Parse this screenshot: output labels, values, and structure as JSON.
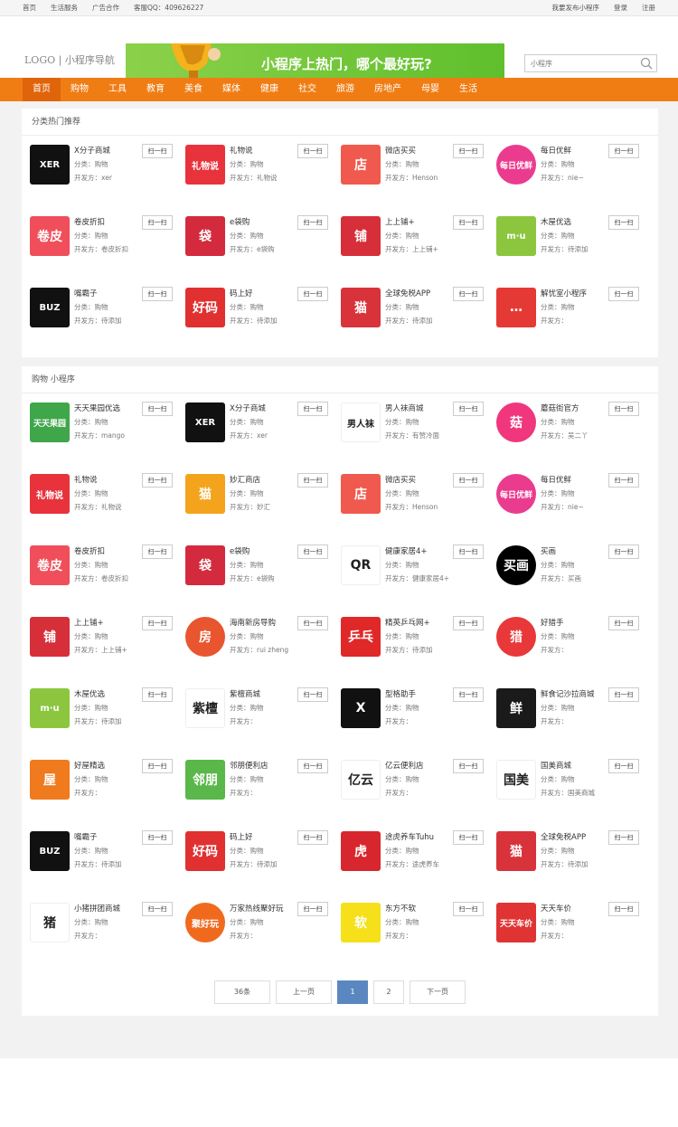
{
  "topbar": {
    "left": [
      "首页",
      "生活服务",
      "广告合作",
      "客服QQ：409626227"
    ],
    "right": [
      "我要发布小程序",
      "登录",
      "注册"
    ]
  },
  "header": {
    "logo": "LOGO | 小程序导航",
    "banner_text": "小程序上热门，哪个最好玩?",
    "search_placeholder": "小程序"
  },
  "nav": {
    "items": [
      "首页",
      "购物",
      "工具",
      "教育",
      "美食",
      "媒体",
      "健康",
      "社交",
      "旅游",
      "房地产",
      "母婴",
      "生活"
    ],
    "active": "首页"
  },
  "sections": [
    {
      "title": "分类热门推荐",
      "cards": [
        {
          "name": "X分子商城",
          "cat": "分类：购物",
          "dev": "开发方：xer",
          "icon": "XER",
          "bg": "#111111"
        },
        {
          "name": "礼物说",
          "cat": "分类：购物",
          "dev": "开发方：礼物说",
          "icon": "礼物说",
          "bg": "#e8333c"
        },
        {
          "name": "微店买买",
          "cat": "分类：购物",
          "dev": "开发方：Henson",
          "icon": "店",
          "bg": "#f05a4e"
        },
        {
          "name": "每日优鲜",
          "cat": "分类：购物",
          "dev": "开发方：nie~",
          "icon": "每日优鲜",
          "bg": "#ea3b8f"
        },
        {
          "name": "卷皮折扣",
          "cat": "分类：购物",
          "dev": "开发方：卷皮折扣",
          "icon": "卷皮",
          "bg": "#f04e5a"
        },
        {
          "name": "e袋购",
          "cat": "分类：购物",
          "dev": "开发方：e袋购",
          "icon": "袋",
          "bg": "#d42a3e"
        },
        {
          "name": "上上铺+",
          "cat": "分类：购物",
          "dev": "开发方：上上铺+",
          "icon": "铺",
          "bg": "#d72f3a"
        },
        {
          "name": "木屋优选",
          "cat": "分类：购物",
          "dev": "开发方：待添加",
          "icon": "m·u",
          "bg": "#8cc63e"
        },
        {
          "name": "嘴霸子",
          "cat": "分类：购物",
          "dev": "开发方：待添加",
          "icon": "BUZ",
          "bg": "#111111"
        },
        {
          "name": "码上好",
          "cat": "分类：购物",
          "dev": "开发方：待添加",
          "icon": "好码",
          "bg": "#e03030"
        },
        {
          "name": "全球免税APP",
          "cat": "分类：购物",
          "dev": "开发方：待添加",
          "icon": "猫",
          "bg": "#d8333a"
        },
        {
          "name": "解忧室小程序",
          "cat": "分类：购物",
          "dev": "开发方：",
          "icon": "…",
          "bg": "#e53935"
        }
      ]
    },
    {
      "title": "购物 小程序",
      "cards": [
        {
          "name": "天天果园优选",
          "cat": "分类：购物",
          "dev": "开发方：mango",
          "icon": "天天果园",
          "bg": "#3fa64a"
        },
        {
          "name": "X分子商城",
          "cat": "分类：购物",
          "dev": "开发方：xer",
          "icon": "XER",
          "bg": "#111111"
        },
        {
          "name": "男人袜商城",
          "cat": "分类：购物",
          "dev": "开发方：有赞冷面",
          "icon": "男人袜",
          "bg": "#ffffff"
        },
        {
          "name": "蘑菇街官方",
          "cat": "分类：购物",
          "dev": "开发方：吴二丫",
          "icon": "菇",
          "bg": "#f0367c"
        },
        {
          "name": "礼物说",
          "cat": "分类：购物",
          "dev": "开发方：礼物说",
          "icon": "礼物说",
          "bg": "#e8333c"
        },
        {
          "name": "妙汇商店",
          "cat": "分类：购物",
          "dev": "开发方：妙汇",
          "icon": "猫",
          "bg": "#f4a41c"
        },
        {
          "name": "微店买买",
          "cat": "分类：购物",
          "dev": "开发方：Henson",
          "icon": "店",
          "bg": "#f05a4e"
        },
        {
          "name": "每日优鲜",
          "cat": "分类：购物",
          "dev": "开发方：nie~",
          "icon": "每日优鲜",
          "bg": "#ea3b8f"
        },
        {
          "name": "卷皮折扣",
          "cat": "分类：购物",
          "dev": "开发方：卷皮折扣",
          "icon": "卷皮",
          "bg": "#f04e5a"
        },
        {
          "name": "e袋购",
          "cat": "分类：购物",
          "dev": "开发方：e袋购",
          "icon": "袋",
          "bg": "#d42a3e"
        },
        {
          "name": "健康家居4+",
          "cat": "分类：购物",
          "dev": "开发方：健康家居4+",
          "icon": "QR",
          "bg": "#ffffff"
        },
        {
          "name": "买画",
          "cat": "分类：购物",
          "dev": "开发方：买画",
          "icon": "买画",
          "bg": "#000000"
        },
        {
          "name": "上上铺+",
          "cat": "分类：购物",
          "dev": "开发方：上上铺+",
          "icon": "铺",
          "bg": "#d72f3a"
        },
        {
          "name": "海南新房导购",
          "cat": "分类：购物",
          "dev": "开发方：rui zheng",
          "icon": "房",
          "bg": "#e8552e"
        },
        {
          "name": "精英乒乓网+",
          "cat": "分类：购物",
          "dev": "开发方：待添加",
          "icon": "乒乓",
          "bg": "#e02828"
        },
        {
          "name": "好猎手",
          "cat": "分类：购物",
          "dev": "开发方：",
          "icon": "猎",
          "bg": "#e8383a"
        },
        {
          "name": "木屋优选",
          "cat": "分类：购物",
          "dev": "开发方：待添加",
          "icon": "m·u",
          "bg": "#8cc63e"
        },
        {
          "name": "紫檀商城",
          "cat": "分类：购物",
          "dev": "开发方：",
          "icon": "紫檀",
          "bg": "#ffffff"
        },
        {
          "name": "型格助手",
          "cat": "分类：购物",
          "dev": "开发方：",
          "icon": "X",
          "bg": "#111111"
        },
        {
          "name": "鲜食记沙拉商城",
          "cat": "分类：购物",
          "dev": "开发方：",
          "icon": "鲜",
          "bg": "#1a1a1a"
        },
        {
          "name": "好屋精选",
          "cat": "分类：购物",
          "dev": "开发方：",
          "icon": "屋",
          "bg": "#f07a1e"
        },
        {
          "name": "邻朋便利店",
          "cat": "分类：购物",
          "dev": "开发方：",
          "icon": "邻朋",
          "bg": "#5ab74a"
        },
        {
          "name": "亿云便利店",
          "cat": "分类：购物",
          "dev": "开发方：",
          "icon": "亿云",
          "bg": "#ffffff"
        },
        {
          "name": "国美商城",
          "cat": "分类：购物",
          "dev": "开发方：国美商城",
          "icon": "国美",
          "bg": "#ffffff"
        },
        {
          "name": "嘴霸子",
          "cat": "分类：购物",
          "dev": "开发方：待添加",
          "icon": "BUZ",
          "bg": "#111111"
        },
        {
          "name": "码上好",
          "cat": "分类：购物",
          "dev": "开发方：待添加",
          "icon": "好码",
          "bg": "#e03030"
        },
        {
          "name": "途虎养车Tuhu",
          "cat": "分类：购物",
          "dev": "开发方：途虎养车",
          "icon": "虎",
          "bg": "#d8262e"
        },
        {
          "name": "全球免税APP",
          "cat": "分类：购物",
          "dev": "开发方：待添加",
          "icon": "猫",
          "bg": "#d8333a"
        },
        {
          "name": "小猪拼团商城",
          "cat": "分类：购物",
          "dev": "开发方：",
          "icon": "猪",
          "bg": "#ffffff"
        },
        {
          "name": "万家热线聚好玩",
          "cat": "分类：购物",
          "dev": "开发方：",
          "icon": "聚好玩",
          "bg": "#f06a1e"
        },
        {
          "name": "东方不软",
          "cat": "分类：购物",
          "dev": "开发方：",
          "icon": "软",
          "bg": "#f5e01a"
        },
        {
          "name": "天天车价",
          "cat": "分类：购物",
          "dev": "开发方：",
          "icon": "天天车价",
          "bg": "#e03434"
        }
      ]
    }
  ],
  "scan_label": "扫一扫",
  "pager": {
    "total": "36条",
    "prev": "上一页",
    "pages": [
      "1",
      "2"
    ],
    "current": "1",
    "next": "下一页"
  }
}
